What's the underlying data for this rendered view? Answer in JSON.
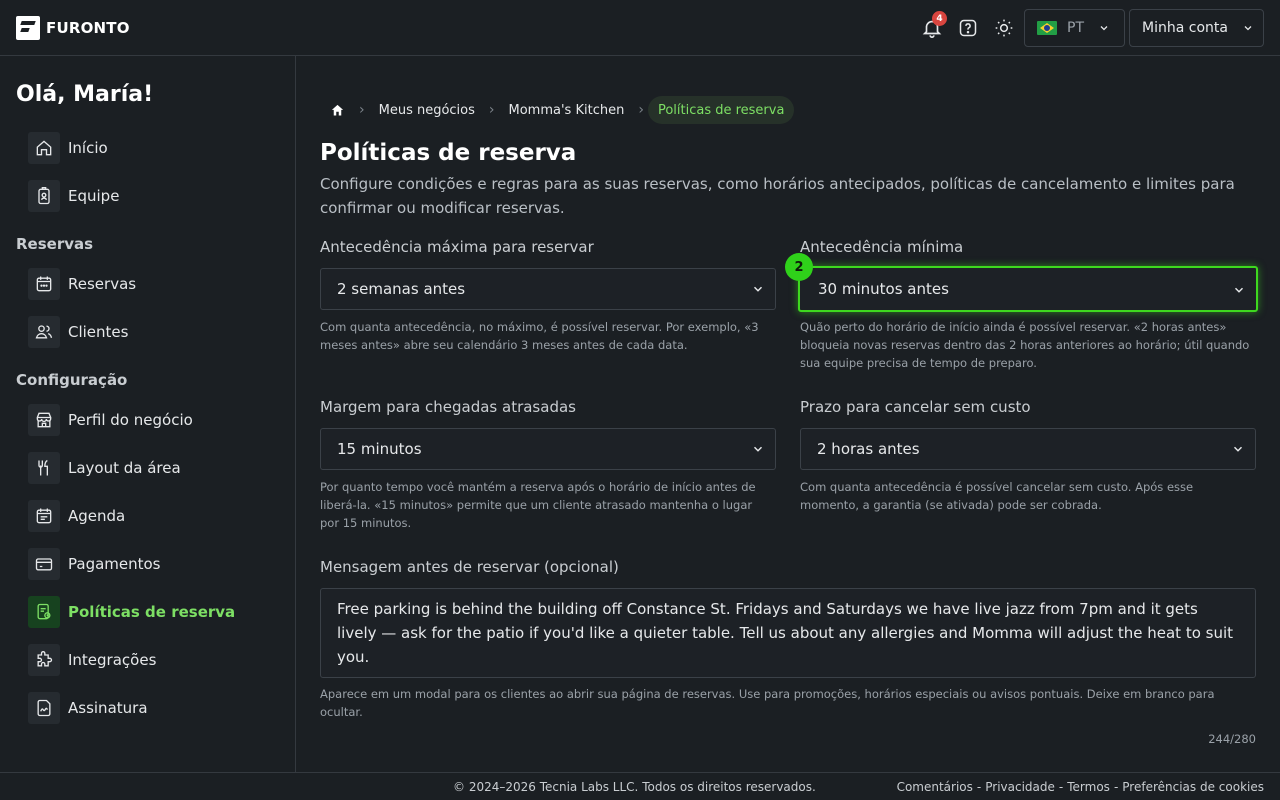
{
  "header": {
    "logo_text": "FURONTO",
    "notification_count": "4",
    "language": "PT",
    "account_label": "Minha conta"
  },
  "sidebar": {
    "greeting": "Olá, María!",
    "items_top": [
      {
        "label": "Início",
        "icon": "home-icon"
      },
      {
        "label": "Equipe",
        "icon": "badge-icon"
      }
    ],
    "section_reservas": "Reservas",
    "items_reservas": [
      {
        "label": "Reservas",
        "icon": "calendar-icon"
      },
      {
        "label": "Clientes",
        "icon": "users-icon"
      }
    ],
    "section_config": "Configuração",
    "items_config": [
      {
        "label": "Perfil do negócio",
        "icon": "store-icon"
      },
      {
        "label": "Layout da área",
        "icon": "cutlery-icon"
      },
      {
        "label": "Agenda",
        "icon": "schedule-icon"
      },
      {
        "label": "Pagamentos",
        "icon": "card-icon"
      },
      {
        "label": "Políticas de reserva",
        "icon": "policy-icon",
        "active": true
      },
      {
        "label": "Integrações",
        "icon": "puzzle-icon"
      },
      {
        "label": "Assinatura",
        "icon": "signature-icon"
      }
    ]
  },
  "breadcrumb": {
    "items": [
      "Meus negócios",
      "Momma's Kitchen"
    ],
    "current": "Políticas de reserva"
  },
  "page": {
    "title": "Políticas de reserva",
    "description": "Configure condições e regras para as suas reservas, como horários antecipados, políticas de cancelamento e limites para confirmar ou modificar reservas."
  },
  "fields": {
    "max_advance": {
      "label": "Antecedência máxima para reservar",
      "value": "2 semanas antes",
      "help": "Com quanta antecedência, no máximo, é possível reservar. Por exemplo, «3 meses antes» abre seu calendário 3 meses antes de cada data."
    },
    "min_advance": {
      "label": "Antecedência mínima",
      "value": "30 minutos antes",
      "help": "Quão perto do horário de início ainda é possível reservar. «2 horas antes» bloqueia novas reservas dentro das 2 horas anteriores ao horário; útil quando sua equipe precisa de tempo de preparo.",
      "marker": "2"
    },
    "late_margin": {
      "label": "Margem para chegadas atrasadas",
      "value": "15 minutos",
      "help": "Por quanto tempo você mantém a reserva após o horário de início antes de liberá-la. «15 minutos» permite que um cliente atrasado mantenha o lugar por 15 minutos."
    },
    "cancel_deadline": {
      "label": "Prazo para cancelar sem custo",
      "value": "2 horas antes",
      "help": "Com quanta antecedência é possível cancelar sem custo. Após esse momento, a garantia (se ativada) pode ser cobrada."
    },
    "message": {
      "label": "Mensagem antes de reservar (opcional)",
      "value": "Free parking is behind the building off Constance St. Fridays and Saturdays we have live jazz from 7pm and it gets lively — ask for the patio if you'd like a quieter table. Tell us about any allergies and Momma will adjust the heat to suit you.",
      "help": "Aparece em um modal para os clientes ao abrir sua página de reservas. Use para promoções, horários especiais ou avisos pontuais. Deixe em branco para ocultar.",
      "counter": "244/280"
    }
  },
  "footer": {
    "copyright": "© 2024–2026 Tecnia Labs LLC. Todos os direitos reservados.",
    "links": [
      "Comentários",
      "Privacidade",
      "Termos",
      "Preferências de cookies"
    ],
    "separator": "-"
  },
  "colors": {
    "accent": "#7ddf64",
    "highlight": "#3ed81f",
    "badge": "#d9453f",
    "background": "#1b1f23"
  }
}
